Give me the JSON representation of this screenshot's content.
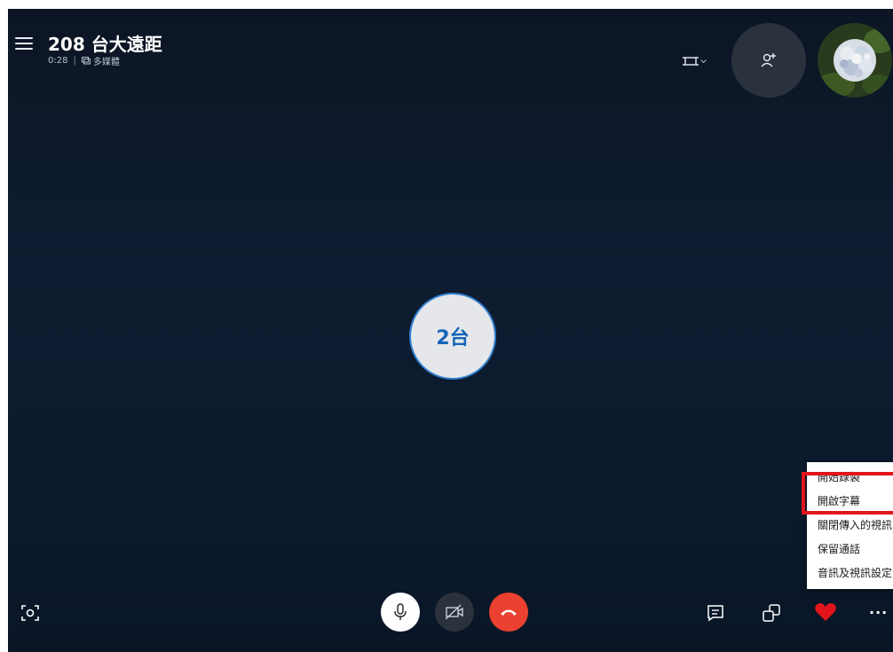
{
  "call": {
    "title": "208 台大遠距",
    "duration": "0:28",
    "separator": "|",
    "media_label": "多媒體"
  },
  "participant": {
    "initials": "2台"
  },
  "icons": {
    "menu": "hamburger-menu-icon",
    "media": "media-icon",
    "layout": "grid-layout-icon",
    "add_person": "add-person-icon",
    "screenshot": "camera-snapshot-icon",
    "mic": "microphone-icon",
    "video": "video-off-icon",
    "hangup": "phone-hangup-icon",
    "chat": "chat-icon",
    "share": "share-screen-icon",
    "react": "heart-icon",
    "more": "more-options-icon"
  },
  "more_glyph": "···",
  "colors": {
    "hangup": "#ea4130",
    "accent": "#2f7fce",
    "heart": "#e3141b",
    "highlight": "#e3141b"
  },
  "menu": {
    "items": [
      {
        "label": "開始錄製"
      },
      {
        "label": "開啟字幕"
      },
      {
        "label": "關閉傳入的視訊"
      },
      {
        "label": "保留通話"
      },
      {
        "label": "音訊及視訊設定"
      }
    ]
  }
}
